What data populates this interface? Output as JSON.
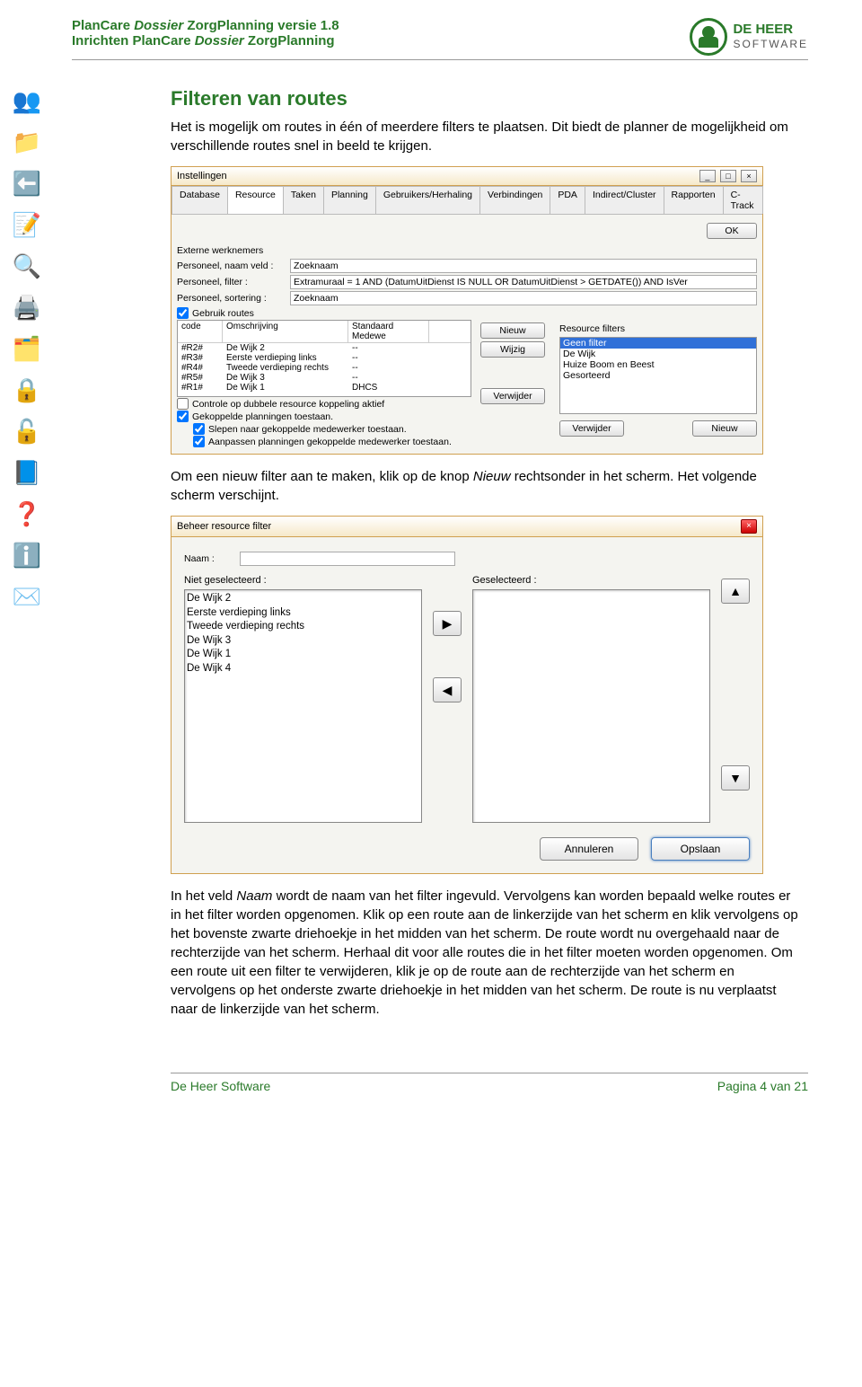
{
  "header": {
    "line1_a": "PlanCare ",
    "line1_b": "Dossier ",
    "line1_c": "ZorgPlanning versie 1.8",
    "line2_a": "Inrichten PlanCare ",
    "line2_b": "Dossier ",
    "line2_c": "ZorgPlanning",
    "logo_top": "DE HEER",
    "logo_bottom": "SOFTWARE"
  },
  "sidebar_icons": [
    "👥",
    "📁",
    "⬅️",
    "📝",
    "🔍",
    "🖨️",
    "🗂️",
    "🔒",
    "🔓",
    "📘",
    "❓",
    "ℹ️",
    "✉️"
  ],
  "section_title": "Filteren van routes",
  "para1": "Het is mogelijk om routes in één of meerdere filters te plaatsen. Dit biedt de planner de mogelijkheid om verschillende routes snel in beeld te krijgen.",
  "ss1": {
    "title": "Instellingen",
    "tabs": [
      "Database",
      "Resource",
      "Taken",
      "Planning",
      "Gebruikers/Herhaling",
      "Verbindingen",
      "PDA",
      "Indirect/Cluster",
      "Rapporten",
      "C-Track"
    ],
    "active_tab": "Resource",
    "ok": "OK",
    "group": "Externe werknemers",
    "f1_lbl": "Personeel, naam veld :",
    "f1_val": "Zoeknaam",
    "f2_lbl": "Personeel, filter :",
    "f2_val": "Extramuraal = 1 AND (DatumUitDienst IS NULL OR DatumUitDienst > GETDATE()) AND IsVer",
    "f3_lbl": "Personeel, sortering :",
    "f3_val": "Zoeknaam",
    "cb_routes": "Gebruik routes",
    "cols": [
      "code",
      "Omschrijving",
      "Standaard Medewe"
    ],
    "rows": [
      [
        "#R2#",
        "De Wijk 2",
        "--"
      ],
      [
        "#R3#",
        "Eerste verdieping links",
        "--"
      ],
      [
        "#R4#",
        "Tweede verdieping rechts",
        "--"
      ],
      [
        "#R5#",
        "De Wijk 3",
        "--"
      ],
      [
        "#R1#",
        "De Wijk 1",
        "DHCS"
      ]
    ],
    "btn_nieuw": "Nieuw",
    "btn_wijzig": "Wijzig",
    "btn_verwijder": "Verwijder",
    "rf_title": "Resource filters",
    "rf_items": [
      "Geen filter",
      "De Wijk",
      "Huize Boom en Beest",
      "Gesorteerd"
    ],
    "cb_dubbel": "Controle op dubbele resource koppeling aktief",
    "cb_gekoppeld": "Gekoppelde planningen toestaan.",
    "cb_slepen": "Slepen naar gekoppelde medewerker toestaan.",
    "cb_aanpassen": "Aanpassen planningen gekoppelde medewerker toestaan."
  },
  "para2_a": "Om een nieuw filter aan te maken, klik op de knop ",
  "para2_i": "Nieuw",
  "para2_b": " rechtsonder in het scherm. Het volgende scherm verschijnt.",
  "ss2": {
    "title": "Beheer resource filter",
    "naam_lbl": "Naam :",
    "left_lbl": "Niet geselecteerd :",
    "right_lbl": "Geselecteerd :",
    "left_items": [
      "De Wijk 2",
      "Eerste verdieping links",
      "Tweede verdieping rechts",
      "De Wijk 3",
      "De Wijk 1",
      "De Wijk 4"
    ],
    "btn_annuleren": "Annuleren",
    "btn_opslaan": "Opslaan"
  },
  "para3_a": "In het veld ",
  "para3_i1": "Naam",
  "para3_b": " wordt de naam van het filter ingevuld. Vervolgens kan worden bepaald welke routes er in het filter worden opgenomen. Klik op een route aan de linkerzijde van het scherm en klik vervolgens op het bovenste zwarte driehoekje in het midden van het scherm. De route wordt nu overgehaald naar de rechterzijde van het scherm. Herhaal dit voor alle routes die in het filter moeten worden opgenomen. Om een route uit een filter te verwijderen, klik je op de route aan de rechterzijde van het scherm en vervolgens op het onderste zwarte driehoekje in het midden van het scherm. De route is nu verplaatst naar de linkerzijde van het scherm.",
  "footer": {
    "left": "De Heer Software",
    "right": "Pagina 4 van 21"
  }
}
